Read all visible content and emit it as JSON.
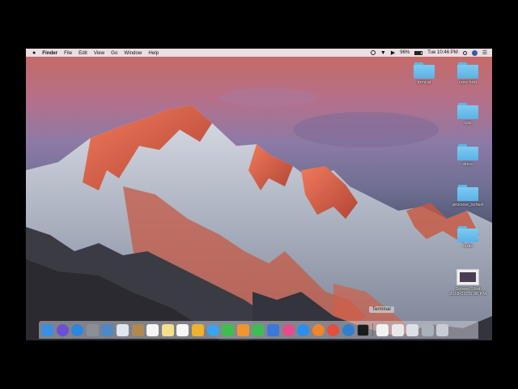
{
  "menubar": {
    "apple": "",
    "app_name": "Finder",
    "menus": [
      "File",
      "Edit",
      "View",
      "Go",
      "Window",
      "Help"
    ],
    "battery": "96%",
    "clock": "Tue 10:46 PM"
  },
  "desktop_icons": [
    {
      "label": "tomcat",
      "type": "folder"
    },
    {
      "label": "core hdd",
      "type": "folder"
    },
    {
      "label": "cpp",
      "type": "folder"
    },
    {
      "label": "docs",
      "type": "folder"
    },
    {
      "label": "process_sched",
      "type": "folder"
    },
    {
      "label": "redis",
      "type": "folder"
    },
    {
      "label": "Screen Shot",
      "label2": "2018-03...5.36 PM",
      "type": "screenshot"
    }
  ],
  "dock": {
    "tooltip": "Terminal",
    "apps": [
      {
        "name": "finder-icon",
        "color": "#3b8fe0"
      },
      {
        "name": "siri-icon",
        "color": "#6b4fd6"
      },
      {
        "name": "safari-icon",
        "color": "#2a86e0"
      },
      {
        "name": "launchpad-icon",
        "color": "#8a8f99"
      },
      {
        "name": "photos-viewer-icon",
        "color": "#4e89c4"
      },
      {
        "name": "preview-icon",
        "color": "#dfe6ee"
      },
      {
        "name": "contacts-icon",
        "color": "#b08850"
      },
      {
        "name": "calendar-icon",
        "color": "#f5f5f5"
      },
      {
        "name": "notes-icon",
        "color": "#f3e08a"
      },
      {
        "name": "reminders-icon",
        "color": "#f7f7f7"
      },
      {
        "name": "photos-icon",
        "color": "#f0b030"
      },
      {
        "name": "messages-icon",
        "color": "#3aa5ef"
      },
      {
        "name": "facetime-icon",
        "color": "#3fbf4a"
      },
      {
        "name": "pages-icon",
        "color": "#f29430"
      },
      {
        "name": "numbers-icon",
        "color": "#3fbb58"
      },
      {
        "name": "keynote-icon",
        "color": "#3b78d8"
      },
      {
        "name": "itunes-icon",
        "color": "#e84a8a"
      },
      {
        "name": "app-store-icon",
        "color": "#2b8ef0"
      },
      {
        "name": "books-icon",
        "color": "#f0852c"
      },
      {
        "name": "chrome-icon",
        "color": "#e54d3d"
      },
      {
        "name": "network-icon",
        "color": "#2d7fd0"
      },
      {
        "name": "terminal-icon",
        "color": "#1b1b1b"
      },
      {
        "name": "document-icon",
        "color": "#f2f2f2"
      },
      {
        "name": "window-thumb-icon",
        "color": "#e8e8ec"
      },
      {
        "name": "window-thumb-icon-2",
        "color": "#dcdfe6"
      },
      {
        "name": "window-thumb-icon-3",
        "color": "#aab0bc"
      },
      {
        "name": "trash-icon",
        "color": "#c9ccd2"
      }
    ]
  }
}
